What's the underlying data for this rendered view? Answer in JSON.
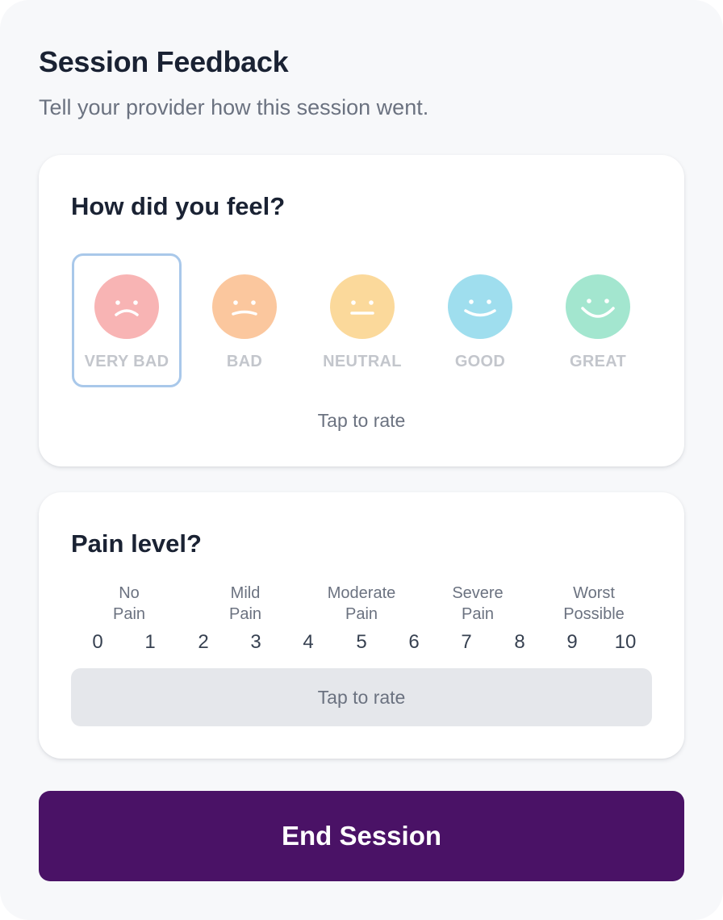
{
  "header": {
    "title": "Session Feedback",
    "subtitle": "Tell your provider how this session went."
  },
  "feel": {
    "title": "How did you feel?",
    "selected_index": 0,
    "options": [
      {
        "label": "VERY BAD",
        "color": "#f8b4b4",
        "icon": "very-bad-face-icon"
      },
      {
        "label": "BAD",
        "color": "#fbc79e",
        "icon": "bad-face-icon"
      },
      {
        "label": "NEUTRAL",
        "color": "#fbd99b",
        "icon": "neutral-face-icon"
      },
      {
        "label": "GOOD",
        "color": "#9fdeee",
        "icon": "good-face-icon"
      },
      {
        "label": "GREAT",
        "color": "#a3e6cf",
        "icon": "great-face-icon"
      }
    ],
    "hint": "Tap to rate"
  },
  "pain": {
    "title": "Pain level?",
    "labels": [
      {
        "line1": "No",
        "line2": "Pain"
      },
      {
        "line1": "Mild",
        "line2": "Pain"
      },
      {
        "line1": "Moderate",
        "line2": "Pain"
      },
      {
        "line1": "Severe",
        "line2": "Pain"
      },
      {
        "line1": "Worst",
        "line2": "Possible"
      }
    ],
    "scale": [
      "0",
      "1",
      "2",
      "3",
      "4",
      "5",
      "6",
      "7",
      "8",
      "9",
      "10"
    ],
    "tap_label": "Tap to rate"
  },
  "actions": {
    "end_session": "End Session"
  },
  "colors": {
    "accent": "#4a1266",
    "selected_border": "#a9c8ea"
  }
}
